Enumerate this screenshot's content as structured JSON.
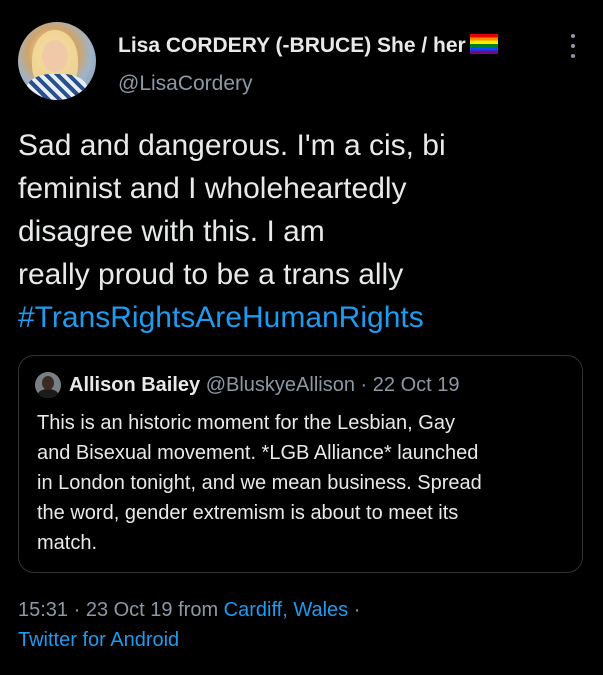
{
  "author": {
    "display_name": "Lisa CORDERY (-BRUCE) She / her",
    "flag_icon": "rainbow-flag-icon",
    "handle": "@LisaCordery"
  },
  "tweet": {
    "lines": [
      "Sad and dangerous. I'm a cis, bi",
      "feminist and I wholeheartedly",
      "disagree with this. I am",
      "really proud to be a trans ally"
    ],
    "hashtag": "#TransRightsAreHumanRights"
  },
  "quoted_tweet": {
    "name": "Allison Bailey",
    "handle": "@BluskyeAllison",
    "separator": "·",
    "date": "22 Oct 19",
    "lines": [
      "This is an historic moment for the Lesbian, Gay",
      "and Bisexual movement.  *LGB Alliance* launched",
      "in London tonight, and we mean business.  Spread",
      "the word, gender extremism is about to meet its",
      "match."
    ]
  },
  "meta": {
    "time_date": "15:31 · 23 Oct 19 from",
    "location": "Cardiff, Wales",
    "separator": "·",
    "source": "Twitter for Android"
  },
  "colors": {
    "background": "#000000",
    "text": "#e7e9ea",
    "secondary": "#8b98a5",
    "link": "#1d9bf0",
    "border": "#2f3336"
  }
}
